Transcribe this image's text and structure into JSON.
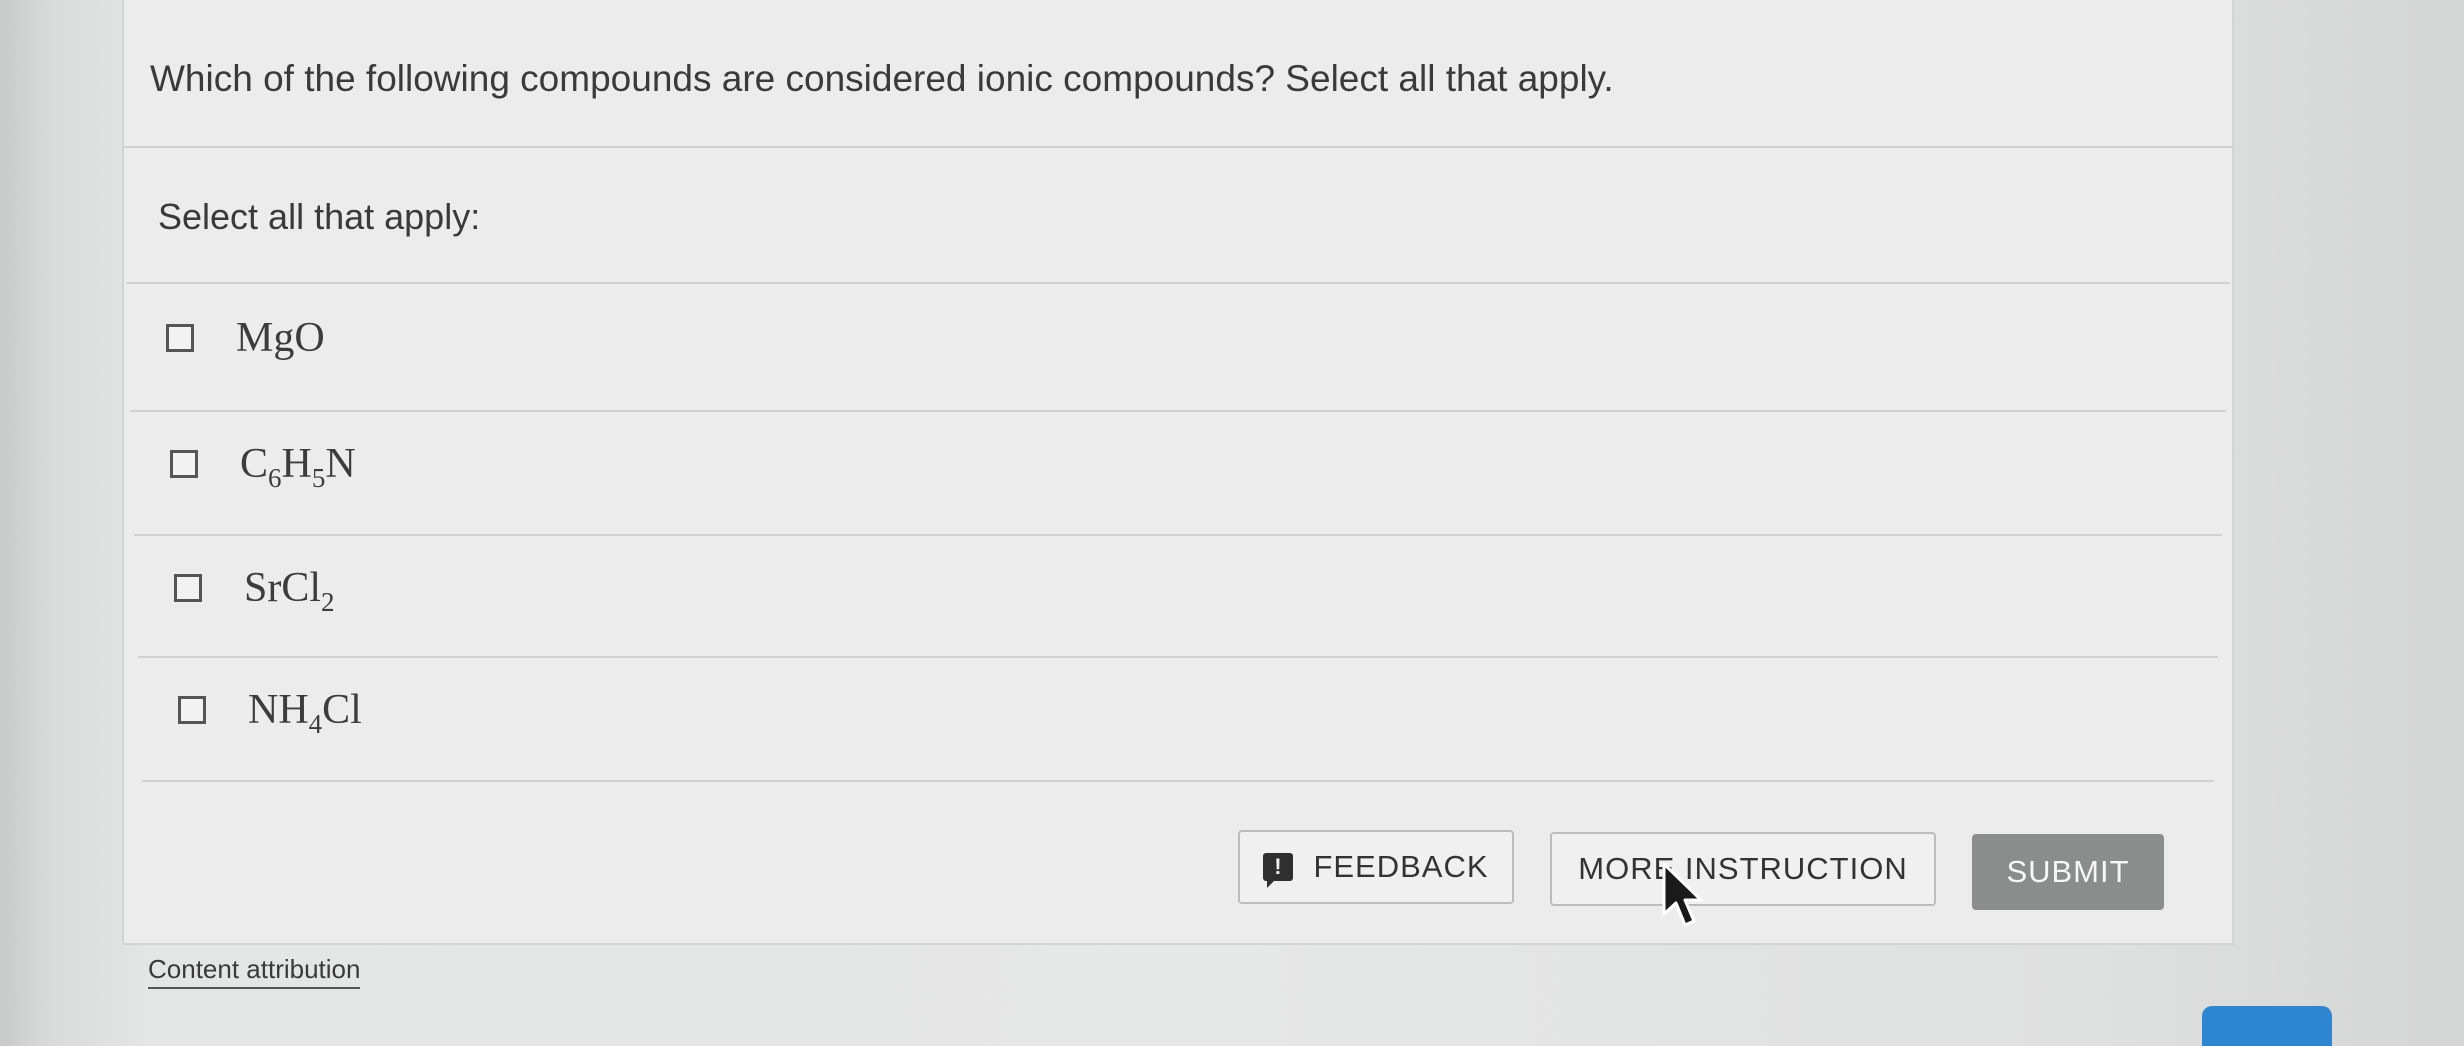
{
  "question": {
    "text": "Which of the following compounds are considered ionic compounds? Select all that apply."
  },
  "instructions": {
    "select_label": "Select all that apply:"
  },
  "options": [
    {
      "base": "MgO",
      "parts": [
        {
          "t": "MgO"
        }
      ],
      "checked": false
    },
    {
      "base": "C6H5N",
      "parts": [
        {
          "t": "C"
        },
        {
          "s": "6"
        },
        {
          "t": "H"
        },
        {
          "s": "5"
        },
        {
          "t": "N"
        }
      ],
      "checked": false
    },
    {
      "base": "SrCl2",
      "parts": [
        {
          "t": "SrCl"
        },
        {
          "s": "2"
        }
      ],
      "checked": false
    },
    {
      "base": "NH4Cl",
      "parts": [
        {
          "t": "NH"
        },
        {
          "s": "4"
        },
        {
          "t": "Cl"
        }
      ],
      "checked": false
    }
  ],
  "buttons": {
    "feedback_icon": "!",
    "feedback_label": "FEEDBACK",
    "more_instruction_label": "MORE INSTRUCTION",
    "submit_label": "SUBMIT"
  },
  "footer": {
    "attribution_label": "Content attribution"
  },
  "colors": {
    "panel_bg": "#ececec",
    "submit_bg": "#8b8c8c",
    "corner_accent": "#2e86d1"
  },
  "icons": {
    "feedback": "feedback-speech-bubble-icon",
    "cursor": "mouse-pointer-icon"
  }
}
